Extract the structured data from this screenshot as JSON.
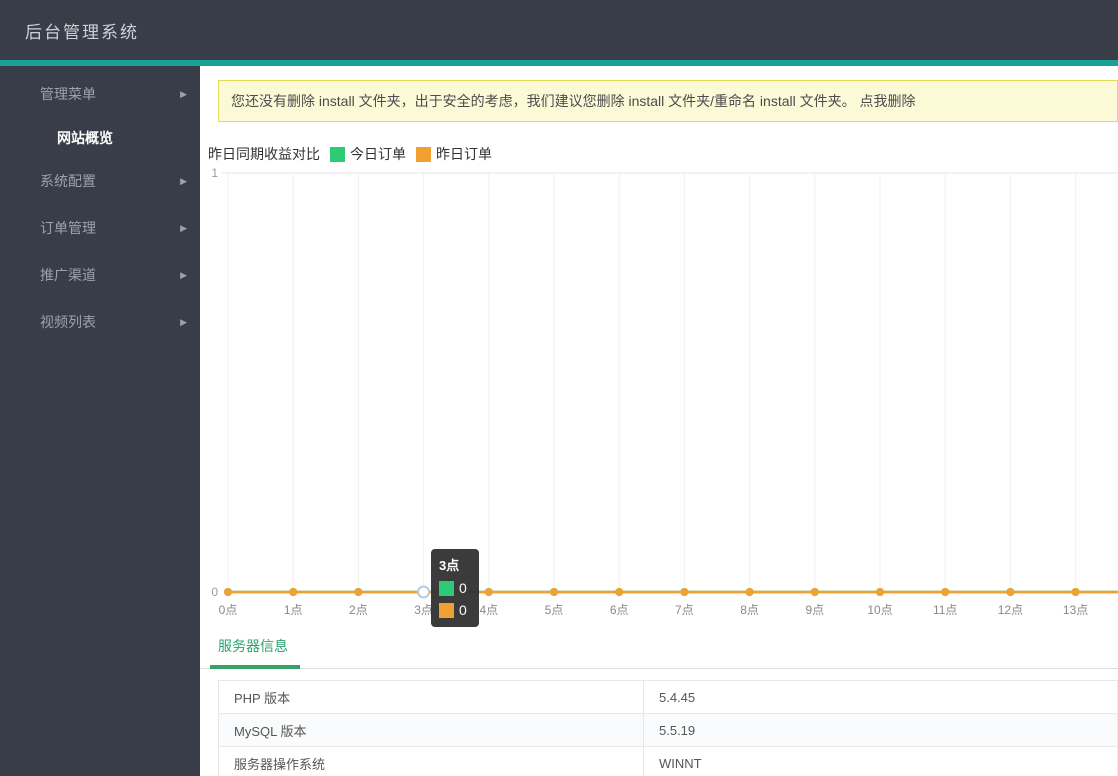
{
  "app": {
    "title": "后台管理系统"
  },
  "colors": {
    "accent_teal": "#18a197",
    "header_dark": "#383d47",
    "today_green": "#2dcb75",
    "yesterday_orange": "#f0a131",
    "banner_bg": "#fcf9d7",
    "banner_border": "#dfdc55",
    "tab_green": "#2ca36f"
  },
  "sidebar": {
    "items": [
      {
        "label": "管理菜单",
        "arrow": true,
        "children": [
          {
            "label": "网站概览",
            "active": true
          }
        ]
      },
      {
        "label": "系统配置",
        "arrow": true
      },
      {
        "label": "订单管理",
        "arrow": true
      },
      {
        "label": "推广渠道",
        "arrow": true
      },
      {
        "label": "视频列表",
        "arrow": true
      }
    ]
  },
  "banner": {
    "text": "您还没有删除 install 文件夹，出于安全的考虑，我们建议您删除 install 文件夹/重命名 install 文件夹。 ",
    "link": "点我删除"
  },
  "chart_data": {
    "type": "line",
    "title": "昨日同期收益对比",
    "x": [
      "0点",
      "1点",
      "2点",
      "3点",
      "4点",
      "5点",
      "6点",
      "7点",
      "8点",
      "9点",
      "10点",
      "11点",
      "12点",
      "13点"
    ],
    "series": [
      {
        "name": "今日订单",
        "color": "#2dcb75",
        "values": [
          0,
          0,
          0,
          0,
          0,
          0,
          0,
          0,
          0,
          0,
          0,
          0,
          0,
          0
        ]
      },
      {
        "name": "昨日订单",
        "color": "#f0a131",
        "values": [
          0,
          0,
          0,
          0,
          0,
          0,
          0,
          0,
          0,
          0,
          0,
          0,
          0,
          0
        ]
      }
    ],
    "ylim": [
      0,
      1
    ],
    "yticks": [
      0,
      1
    ],
    "hovered_index": 3,
    "grid": true,
    "legend_position": "top"
  },
  "tooltip": {
    "title": "3点",
    "series": [
      {
        "name": "今日订单",
        "color": "#2dcb75",
        "value": "0"
      },
      {
        "name": "昨日订单",
        "color": "#f0a131",
        "value": "0"
      }
    ]
  },
  "server_info": {
    "tab": "服务器信息",
    "rows": [
      {
        "label": "PHP 版本",
        "value": "5.4.45"
      },
      {
        "label": "MySQL 版本",
        "value": "5.5.19"
      },
      {
        "label": "服务器操作系统",
        "value": "WINNT"
      }
    ]
  }
}
